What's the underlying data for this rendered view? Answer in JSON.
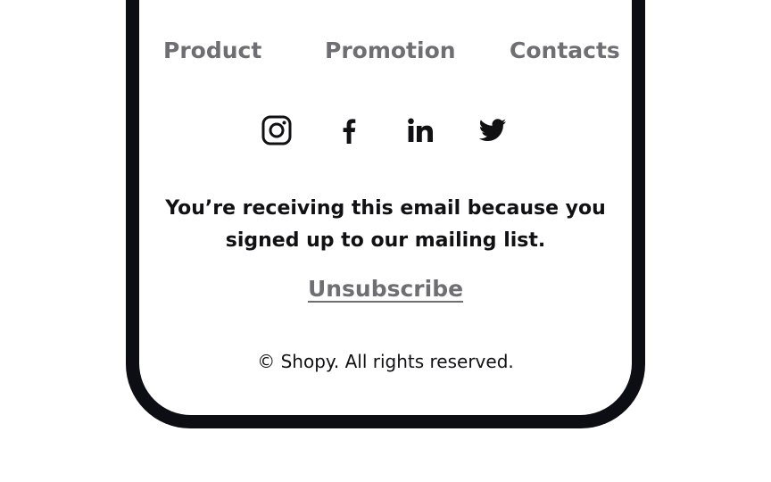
{
  "nav": {
    "items": [
      {
        "label": "Product"
      },
      {
        "label": "Promotion"
      },
      {
        "label": "Contacts"
      }
    ]
  },
  "social": {
    "icons": [
      "instagram-icon",
      "facebook-icon",
      "linkedin-icon",
      "twitter-icon"
    ]
  },
  "footer": {
    "notice_line1": "You’re receiving this email because you",
    "notice_line2": "signed up to our mailing list.",
    "unsubscribe_label": "Unsubscribe",
    "copyright": "© Shopy. All rights reserved."
  },
  "colors": {
    "frame": "#0d0e14",
    "link_gray": "#6f6f73",
    "text_dark": "#111114",
    "background": "#ffffff"
  }
}
